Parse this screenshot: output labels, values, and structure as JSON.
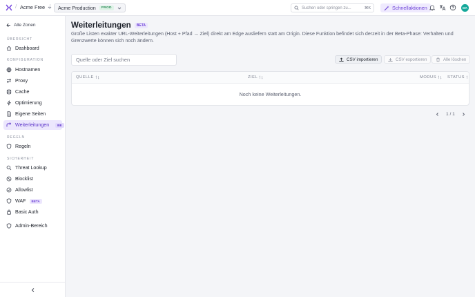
{
  "topbar": {
    "org_name": "Acme Free",
    "separator": "/",
    "zone_name": "Acme Production",
    "zone_env": "PROD",
    "search_placeholder": "Suchen oder springen zu...",
    "search_shortcut": "⌘K",
    "quick_actions": "Schnellaktionen",
    "avatar_initials": "DA"
  },
  "sidebar": {
    "back_label": "Alle Zonen",
    "sections": {
      "overview": "ÜBERSICHT",
      "config": "KONFIGURATION",
      "rules": "REGELN",
      "security": "SICHERHEIT"
    },
    "items": {
      "dashboard": "Dashboard",
      "hostnames": "Hostnamen",
      "proxy": "Proxy",
      "cache": "Cache",
      "optimization": "Optimierung",
      "custom_pages": "Eigene Seiten",
      "redirects": "Weiterleitungen",
      "redirects_badge": "BE",
      "rules": "Regeln",
      "threat_lookup": "Threat Lookup",
      "blocklist": "Blocklist",
      "allowlist": "Allowlist",
      "waf": "WAF",
      "waf_badge": "BETA",
      "basic_auth": "Basic Auth",
      "admin": "Admin-Bereich"
    }
  },
  "page": {
    "title": "Weiterleitungen",
    "title_badge": "BETA",
    "description": "Große Listen exakter URL-Weiterleitungen (Host + Pfad → Ziel) direkt am Edge ausliefern statt am Origin. Diese Funktion befindet sich derzeit in der Beta-Phase: Verhalten und Grenzwerte können sich noch ändern.",
    "filter_placeholder": "Quelle oder Ziel suchen",
    "import_csv": "CSV importieren",
    "export_csv": "CSV exportieren",
    "delete_all": "Alle löschen",
    "columns": {
      "source": "QUELLE",
      "target": "ZIEL",
      "mode": "MODUS",
      "status": "STATUS"
    },
    "empty_text": "Noch keine Weiterleitungen.",
    "pagination": "1 / 1"
  },
  "colors": {
    "accent": "#6b3fd6",
    "active_bg": "#ece7fd",
    "prod_green": "#2f8d5a",
    "avatar": "#14a89a"
  }
}
